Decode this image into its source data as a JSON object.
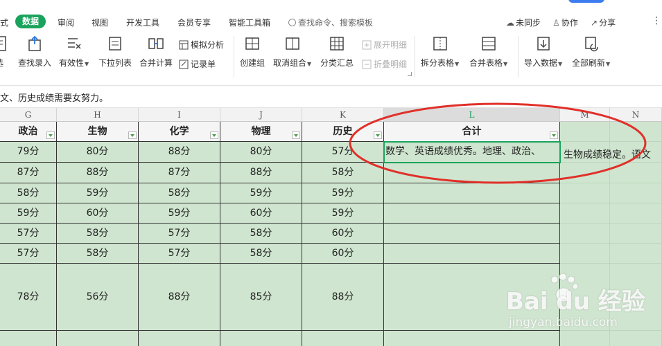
{
  "menubar": {
    "items": [
      "式",
      "数据",
      "审阅",
      "视图",
      "开发工具",
      "会员专享",
      "智能工具箱"
    ],
    "active_index": 1,
    "search_placeholder": "查找命令、搜索模板",
    "sync_label": "未同步",
    "collab_label": "协作",
    "share_label": "分享",
    "more_label": "⋮"
  },
  "ribbon": {
    "tools": [
      {
        "label": "选",
        "icon": "data-validation-icon"
      },
      {
        "label": "查找录入",
        "icon": "lookup-entry-icon"
      },
      {
        "label": "有效性",
        "icon": "validity-icon",
        "has_caret": true
      },
      {
        "label": "下拉列表",
        "icon": "dropdown-list-icon"
      },
      {
        "label": "合并计算",
        "icon": "consolidate-icon"
      },
      {
        "label": "创建组",
        "icon": "create-group-icon"
      },
      {
        "label": "取消组合",
        "icon": "ungroup-icon",
        "has_caret": true
      },
      {
        "label": "分类汇总",
        "icon": "subtotal-icon"
      },
      {
        "label": "拆分表格",
        "icon": "split-table-icon",
        "has_caret": true
      },
      {
        "label": "合并表格",
        "icon": "merge-table-icon",
        "has_caret": true
      },
      {
        "label": "导入数据",
        "icon": "import-data-icon",
        "has_caret": true
      },
      {
        "label": "全部刷新",
        "icon": "refresh-all-icon",
        "has_caret": true
      }
    ],
    "small_tools": {
      "simulate": "模拟分析",
      "record": "记录单",
      "expand_detail": "展开明细",
      "collapse_detail": "折叠明细"
    }
  },
  "formula_bar": {
    "text": "文、历史成绩需要女努力。"
  },
  "sheet": {
    "columns": [
      "G",
      "H",
      "I",
      "J",
      "K",
      "L",
      "M",
      "N"
    ],
    "selected_column": "L",
    "headers": [
      "政治",
      "生物",
      "化学",
      "物理",
      "历史",
      "合计"
    ],
    "rows": [
      [
        "79分",
        "80分",
        "88分",
        "80分",
        "57分"
      ],
      [
        "87分",
        "88分",
        "87分",
        "88分",
        "58分"
      ],
      [
        "58分",
        "59分",
        "58分",
        "59分",
        "59分"
      ],
      [
        "59分",
        "60分",
        "59分",
        "60分",
        "59分"
      ],
      [
        "57分",
        "58分",
        "57分",
        "58分",
        "60分"
      ],
      [
        "57分",
        "58分",
        "57分",
        "58分",
        "60分"
      ],
      [
        "78分",
        "56分",
        "88分",
        "85分",
        "88分"
      ]
    ],
    "total_cell_text": "数学、英语成绩优秀。地理、政治、",
    "overflow_text": "生物成绩稳定。语文"
  },
  "watermark": {
    "logo": "Bai du 经验",
    "url": "jingyan.baidu.com"
  },
  "colors": {
    "accent": "#1aa35c",
    "cell_fill": "#cfe5cf",
    "annotation": "#e0302a"
  }
}
